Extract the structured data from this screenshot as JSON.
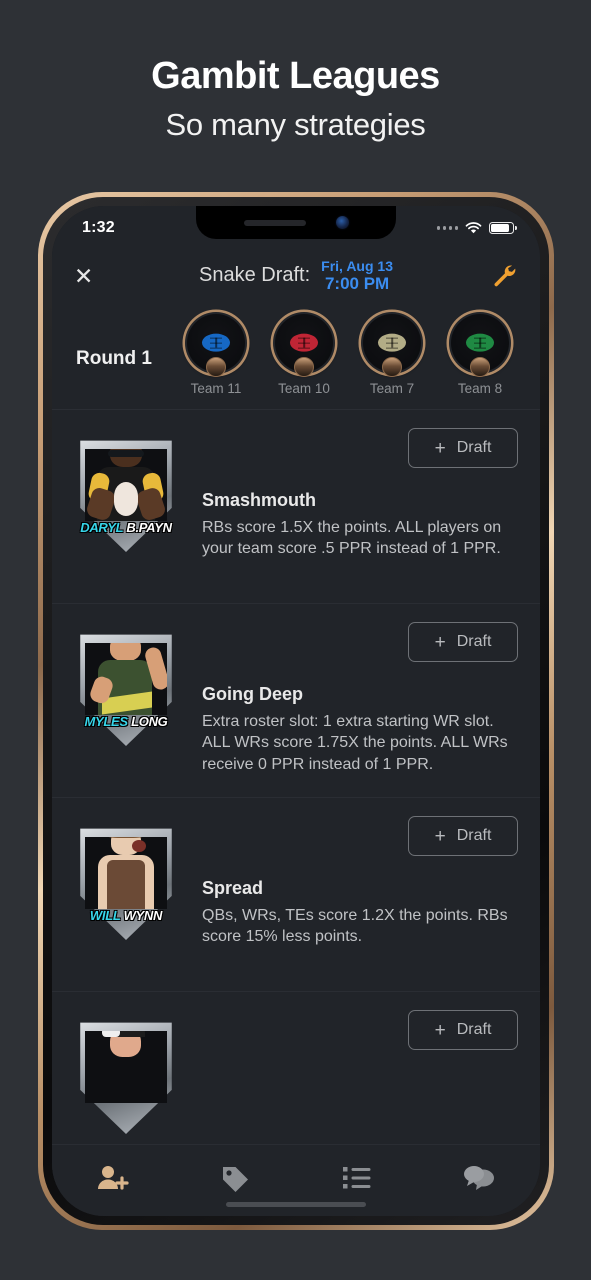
{
  "promo": {
    "title": "Gambit Leagues",
    "subtitle": "So many strategies"
  },
  "status_bar": {
    "time": "1:32",
    "signal_icon": "signal-dots-icon",
    "wifi_icon": "wifi-icon",
    "battery_icon": "battery-icon"
  },
  "navbar": {
    "close_icon": "close-icon",
    "title": "Snake Draft:",
    "date": "Fri, Aug 13",
    "time": "7:00 PM",
    "tools_icon": "wrench-icon",
    "accent_blue": "#3b8df0",
    "accent_orange": "#f0a030"
  },
  "round": {
    "label": "Round 1",
    "teams": [
      {
        "name": "Team 11",
        "ball_color": "#1668c4"
      },
      {
        "name": "Team 10",
        "ball_color": "#c02535"
      },
      {
        "name": "Team 7",
        "ball_color": "#b2ac86"
      },
      {
        "name": "Team 8",
        "ball_color": "#1f8a43"
      }
    ]
  },
  "strategies": [
    {
      "title": "Smashmouth",
      "description": "RBs score 1.5X the points. ALL players on your team score .5 PPR instead of 1 PPR.",
      "draft_label": "Draft",
      "draft_plus": "+",
      "emblem": {
        "name_first": "DARYL",
        "name_last": "B.PAYN",
        "skin": "#5a3a26",
        "shirt": "#171717",
        "accent": "#e8b93a"
      }
    },
    {
      "title": "Going Deep",
      "description": "Extra roster slot: 1 extra starting WR slot. ALL WRs score 1.75X the points. ALL WRs receive 0 PPR instead of 1 PPR.",
      "draft_label": "Draft",
      "draft_plus": "+",
      "emblem": {
        "name_first": "MYLES",
        "name_last": "LONG",
        "skin": "#d79f77",
        "shirt": "#3c5130",
        "accent": "#d8cf52"
      }
    },
    {
      "title": "Spread",
      "description": "QBs, WRs, TEs score 1.2X the points. RBs score 15% less points.",
      "draft_label": "Draft",
      "draft_plus": "+",
      "emblem": {
        "name_first": "WILL",
        "name_last": "WYNN",
        "skin": "#e8cbb0",
        "shirt": "#6b4a36",
        "accent": "#7a3028"
      }
    },
    {
      "title": "",
      "description": "",
      "draft_label": "Draft",
      "draft_plus": "+",
      "emblem": {
        "name_first": "",
        "name_last": "",
        "skin": "#e0a98c",
        "shirt": "#9aa0a6",
        "accent": "#1c1c1c"
      }
    }
  ],
  "tabbar": {
    "items": [
      {
        "icon": "person-add-icon",
        "active": true
      },
      {
        "icon": "tag-icon",
        "active": false
      },
      {
        "icon": "list-icon",
        "active": false
      },
      {
        "icon": "chat-bubbles-icon",
        "active": false
      }
    ],
    "active_color": "#d9b58c",
    "inactive_color": "#8b8e92"
  }
}
